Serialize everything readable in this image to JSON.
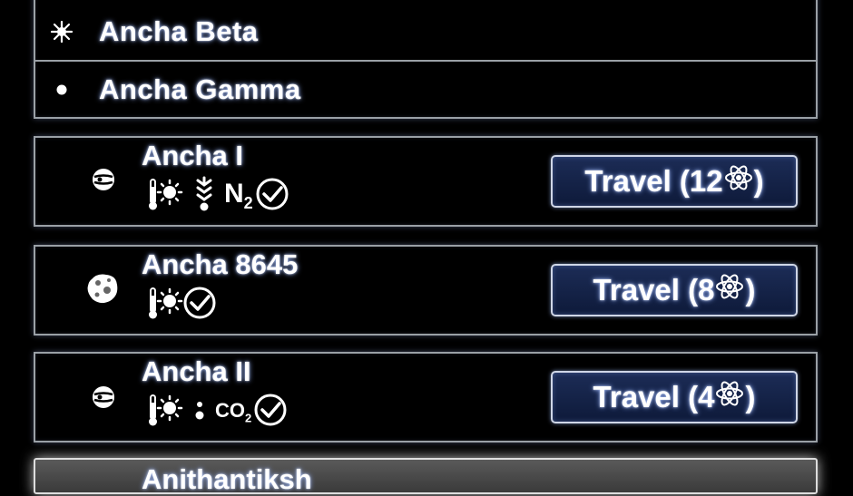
{
  "stars": [
    {
      "name": "Ancha Beta",
      "icon": "star-burst-icon"
    },
    {
      "name": "Ancha Gamma",
      "icon": "small-star-icon"
    }
  ],
  "planets": [
    {
      "name": "Ancha I",
      "icon": "gas-planet-icon",
      "props": [
        "hot-temperature-icon",
        "gas-giant-icon",
        "N2",
        "check-icon"
      ],
      "travel_label": "Travel (12",
      "travel_suffix": ")"
    },
    {
      "name": "Ancha 8645",
      "icon": "asteroid-icon",
      "props": [
        "hot-temperature-icon",
        "check-icon"
      ],
      "travel_label": "Travel (8",
      "travel_suffix": ")"
    },
    {
      "name": "Ancha II",
      "icon": "gas-planet-icon",
      "props": [
        "hot-temperature-icon",
        "dot-icon",
        "CO2",
        "check-icon"
      ],
      "travel_label": "Travel (4",
      "travel_suffix": ")"
    }
  ],
  "partial_planet": {
    "name": "Anithantiksh"
  },
  "colors": {
    "button_bg": "#152449",
    "border": "#9aa0a6",
    "background": "#000000"
  }
}
